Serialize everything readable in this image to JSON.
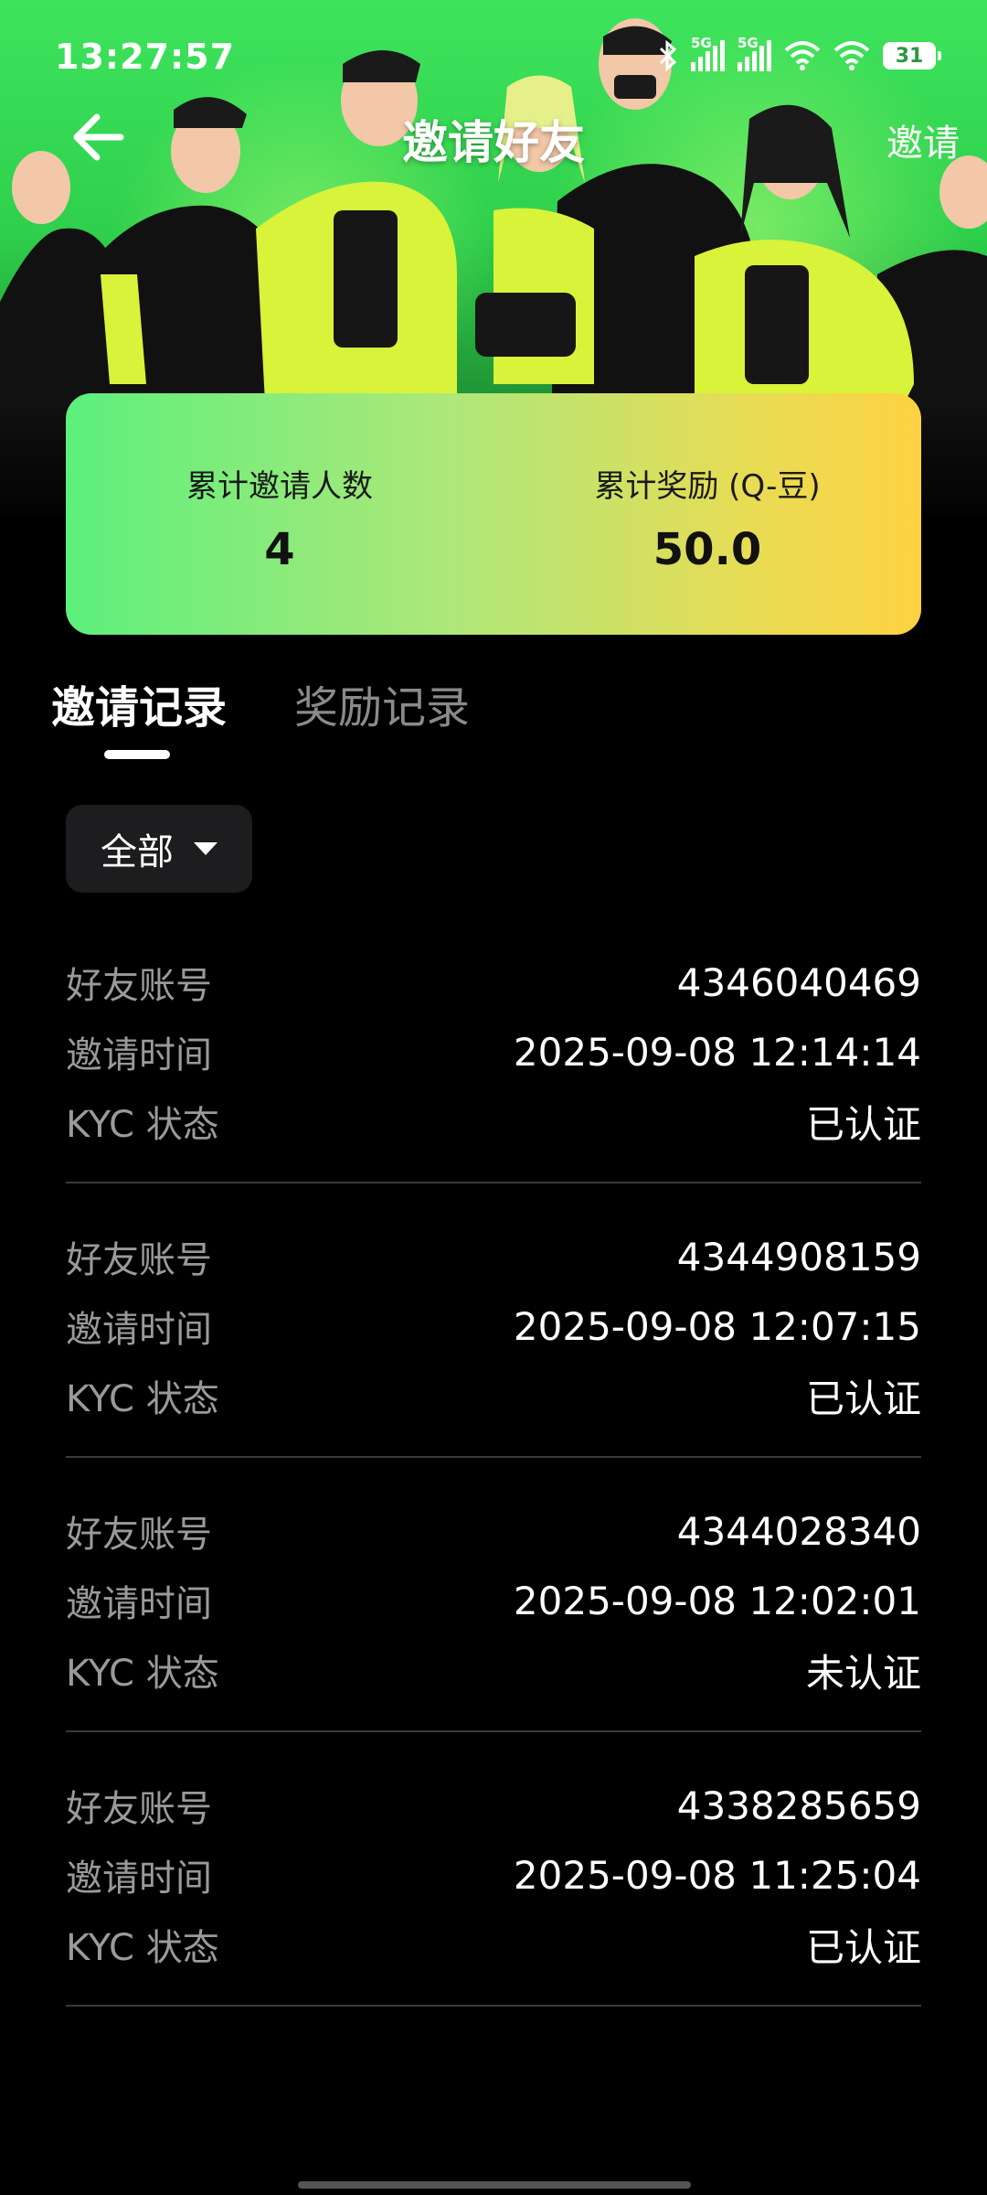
{
  "status": {
    "time": "13:27:57",
    "network_labels": [
      "5G",
      "5G"
    ],
    "battery": "31"
  },
  "nav": {
    "title": "邀请好友",
    "right_action": "邀请"
  },
  "stats": {
    "invite_count_label": "累计邀请人数",
    "invite_count_value": "4",
    "reward_label": "累计奖励 (Q-豆)",
    "reward_value": "50.0"
  },
  "tabs": [
    {
      "label": "邀请记录",
      "active": true
    },
    {
      "label": "奖励记录",
      "active": false
    }
  ],
  "filter": {
    "selected": "全部"
  },
  "labels": {
    "account": "好友账号",
    "time": "邀请时间",
    "kyc": "KYC 状态"
  },
  "records": [
    {
      "account": "4346040469",
      "time": "2025-09-08 12:14:14",
      "kyc": "已认证"
    },
    {
      "account": "4344908159",
      "time": "2025-09-08 12:07:15",
      "kyc": "已认证"
    },
    {
      "account": "4344028340",
      "time": "2025-09-08 12:02:01",
      "kyc": "未认证"
    },
    {
      "account": "4338285659",
      "time": "2025-09-08 11:25:04",
      "kyc": "已认证"
    }
  ],
  "colors": {
    "hero_green": "#3ee35c",
    "card_gradient_start": "#5cf07c",
    "card_gradient_end": "#fdd241",
    "background": "#000000",
    "muted_text": "#9a9a9a"
  }
}
